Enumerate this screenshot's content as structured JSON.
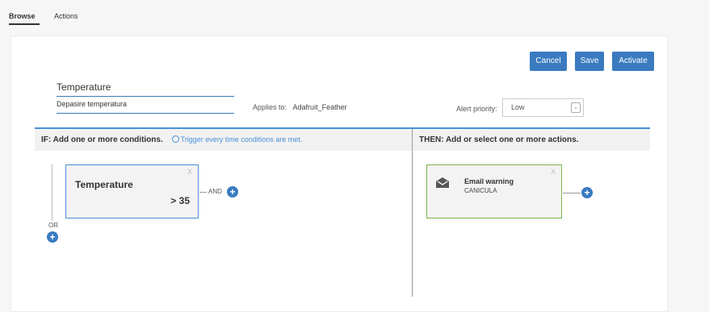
{
  "tabs": [
    {
      "label": "Browse",
      "active": true
    },
    {
      "label": "Actions",
      "active": false
    }
  ],
  "toolbar": {
    "cancel_label": "Cancel",
    "save_label": "Save",
    "activate_label": "Activate"
  },
  "rule": {
    "name": "Temperature",
    "description": "Depasire temperatura",
    "applies_to_label": "Applies to:",
    "applies_to_value": "Adafruit_Feather",
    "priority_label": "Alert priority:",
    "priority_value": "Low"
  },
  "if_section": {
    "title": "IF: Add one or more conditions.",
    "hint": "Trigger every time conditions are met.",
    "or_label": "OR",
    "and_label": "AND",
    "condition": {
      "title": "Temperature",
      "value": "> 35",
      "close": "X"
    }
  },
  "then_section": {
    "title": "THEN: Add or select one or more actions.",
    "action": {
      "title": "Email warning",
      "subtitle": "CANICULA",
      "close": "X",
      "icon": "envelope-open-icon"
    }
  },
  "colors": {
    "accent": "#3a7bc0",
    "condition_border": "#4a90d9",
    "action_border": "#7ab648"
  }
}
